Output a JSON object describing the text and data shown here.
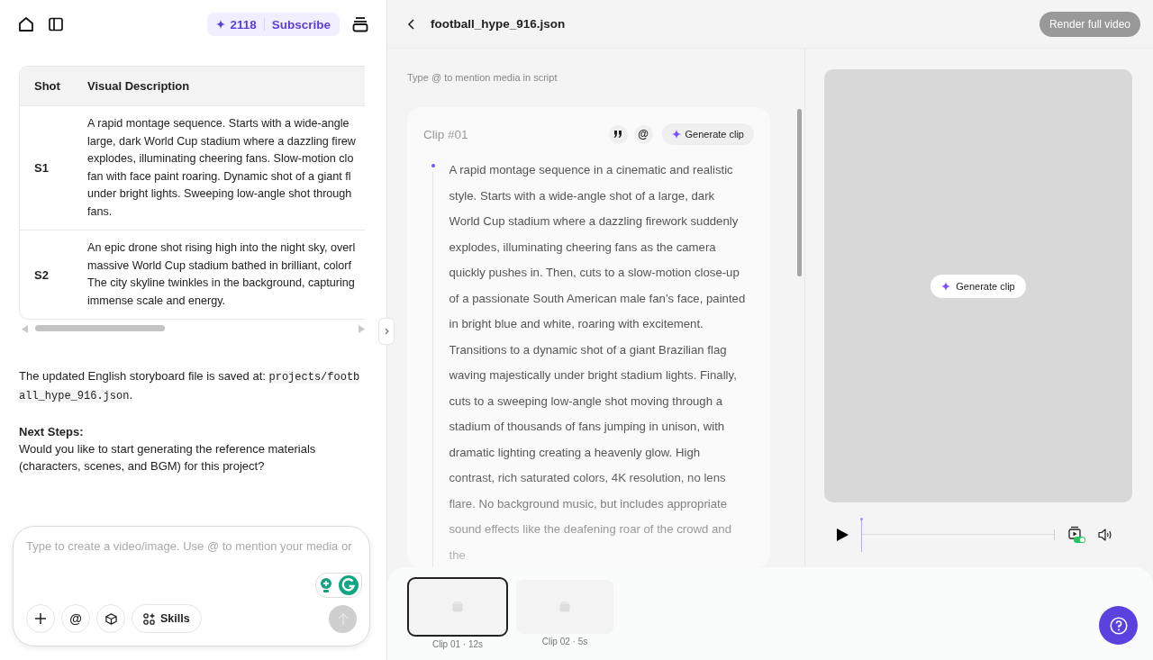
{
  "topbar": {
    "credits": "2118",
    "subscribe": "Subscribe"
  },
  "storyboard_table": {
    "columns": [
      "Shot",
      "Visual Description"
    ],
    "rows": [
      {
        "shot": "S1",
        "description_lines": [
          "A rapid montage sequence. Starts with a wide-angle",
          "large, dark World Cup stadium where a dazzling firew",
          "explodes, illuminating cheering fans. Slow-motion clo",
          "fan with face paint roaring. Dynamic shot of a giant fl",
          "under bright lights. Sweeping low-angle shot through",
          "fans."
        ]
      },
      {
        "shot": "S2",
        "description_lines": [
          "An epic drone shot rising high into the night sky, overl",
          "massive World Cup stadium bathed in brilliant, colorf",
          "The city skyline twinkles in the background, capturing",
          "immense scale and energy."
        ]
      }
    ]
  },
  "message": {
    "saved_text": "The updated English storyboard file is saved at: ",
    "file_path": "projects/football_hype_916.json",
    "saved_end": ".",
    "next_steps_heading": "Next Steps:",
    "question": "Would you like to start generating the reference materials (characters, scenes, and BGM) for this project?"
  },
  "composer": {
    "placeholder": "Type to create a video/image. Use @ to mention your media or",
    "mention_button": "@",
    "skills_button": "Skills",
    "send_disabled": true
  },
  "editor": {
    "title": "football_hype_916.json",
    "render_button": {
      "label": "Render full video",
      "disabled": true
    },
    "hint": "Type @ to mention media in script",
    "clips": [
      {
        "label": "Clip #01",
        "mention_button": "@",
        "generate_button": "Generate clip",
        "script": "A rapid montage sequence in a cinematic and realistic style. Starts with a wide-angle shot of a large, dark World Cup stadium where a dazzling firework suddenly explodes, illuminating cheering fans as the camera quickly pushes in. Then, cuts to a slow-motion close-up of a passionate South American male fan's face, painted in bright blue and white, roaring with excitement. Transitions to a dynamic shot of a giant Brazilian flag waving majestically under bright stadium lights. Finally, cuts to a sweeping low-angle shot moving through a stadium of thousands of fans jumping in unison, with dramatic lighting creating a heavenly glow. High contrast, rich saturated colors, 4K resolution, no lens flare. No background music, but includes appropriate sound effects like the deafening roar of the crowd and the"
      }
    ]
  },
  "preview": {
    "generate_button": "Generate clip",
    "autoplay_toggle": {
      "on": true
    }
  },
  "timeline": {
    "clips": [
      {
        "label": "Clip 01 · 12s",
        "selected": true
      },
      {
        "label": "Clip 02 · 5s",
        "selected": false
      }
    ]
  }
}
